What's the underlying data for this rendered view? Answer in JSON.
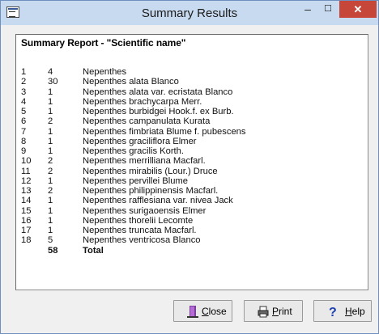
{
  "window": {
    "title": "Summary Results"
  },
  "report": {
    "title": "Summary Report - \"Scientific name\"",
    "rows": [
      {
        "n": "1",
        "count": "4",
        "name": "Nepenthes"
      },
      {
        "n": "2",
        "count": "30",
        "name": "Nepenthes alata Blanco"
      },
      {
        "n": "3",
        "count": "1",
        "name": "Nepenthes alata var. ecristata Blanco"
      },
      {
        "n": "4",
        "count": "1",
        "name": "Nepenthes brachycarpa Merr."
      },
      {
        "n": "5",
        "count": "1",
        "name": "Nepenthes burbidgei Hook.f. ex Burb."
      },
      {
        "n": "6",
        "count": "2",
        "name": "Nepenthes campanulata Kurata"
      },
      {
        "n": "7",
        "count": "1",
        "name": "Nepenthes fimbriata Blume f. pubescens"
      },
      {
        "n": "8",
        "count": "1",
        "name": "Nepenthes graciliflora Elmer"
      },
      {
        "n": "9",
        "count": "1",
        "name": "Nepenthes gracilis Korth."
      },
      {
        "n": "10",
        "count": "2",
        "name": "Nepenthes merrilliana Macfarl."
      },
      {
        "n": "11",
        "count": "2",
        "name": "Nepenthes mirabilis (Lour.) Druce"
      },
      {
        "n": "12",
        "count": "1",
        "name": "Nepenthes pervillei Blume"
      },
      {
        "n": "13",
        "count": "2",
        "name": "Nepenthes philippinensis Macfarl."
      },
      {
        "n": "14",
        "count": "1",
        "name": "Nepenthes rafflesiana var. nivea Jack"
      },
      {
        "n": "15",
        "count": "1",
        "name": "Nepenthes surigaoensis Elmer"
      },
      {
        "n": "16",
        "count": "1",
        "name": "Nepenthes thorelii Lecomte"
      },
      {
        "n": "17",
        "count": "1",
        "name": "Nepenthes truncata Macfarl."
      },
      {
        "n": "18",
        "count": "5",
        "name": "Nepenthes ventricosa Blanco"
      }
    ],
    "total": {
      "count": "58",
      "label": "Total"
    }
  },
  "buttons": {
    "close": {
      "label_rest": "lose",
      "label_ul": "C",
      "icon": "door-exit-icon"
    },
    "print": {
      "label_rest": "rint",
      "label_ul": "P",
      "icon": "printer-icon"
    },
    "help": {
      "label_rest": "elp",
      "label_ul": "H",
      "icon": "question-mark-icon"
    }
  },
  "colors": {
    "titlebar": "#c8daf0",
    "close_button": "#c7463a"
  }
}
